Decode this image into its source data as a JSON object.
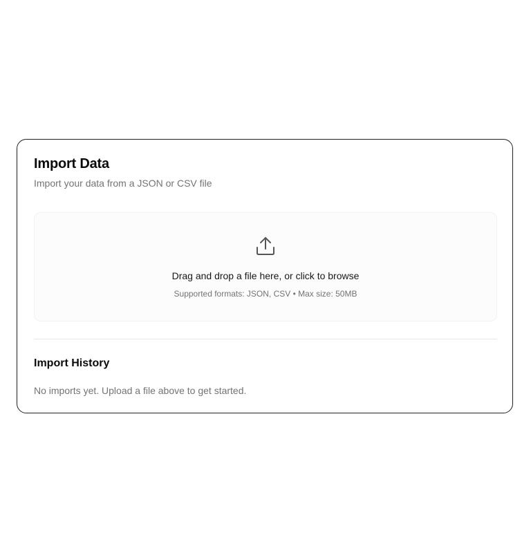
{
  "import": {
    "title": "Import Data",
    "subtitle": "Import your data from a JSON or CSV file"
  },
  "dropzone": {
    "icon": "upload-icon",
    "primary_text": "Drag and drop a file here, or click to browse",
    "secondary_text": "Supported formats: JSON, CSV • Max size: 50MB"
  },
  "history": {
    "title": "Import History",
    "empty_text": "No imports yet. Upload a file above to get started."
  },
  "colors": {
    "border": "#1f1f1f",
    "muted_text": "#737373",
    "icon": "#555555"
  }
}
